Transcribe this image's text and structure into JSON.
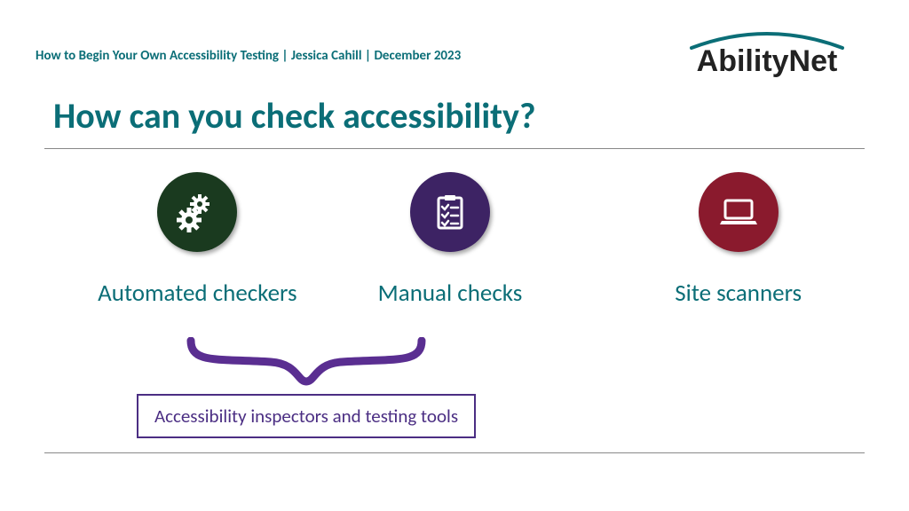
{
  "header": {
    "breadcrumb": "How to Begin Your Own Accessibility Testing | Jessica Cahill | December 2023",
    "logo_text": "AbilityNet"
  },
  "title": "How can you check accessibility?",
  "methods": [
    {
      "label": "Automated checkers",
      "circle_color": "#1a3a1f",
      "icon": "gears"
    },
    {
      "label": "Manual checks",
      "circle_color": "#3d2364",
      "icon": "checklist"
    },
    {
      "label": "Site scanners",
      "circle_color": "#8a1a2d",
      "icon": "laptop"
    }
  ],
  "grouping": {
    "label": "Accessibility inspectors and testing tools",
    "brace_color": "#5a2e91"
  }
}
